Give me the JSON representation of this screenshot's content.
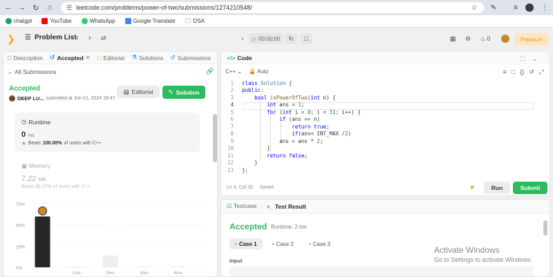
{
  "browser": {
    "url": "leetcode.com/problems/power-of-two/submissions/1274210548/",
    "bookmarks": [
      {
        "label": "chatgpt",
        "color": "#10a37f"
      },
      {
        "label": "YouTube",
        "color": "#ff0000"
      },
      {
        "label": "WhatsApp",
        "color": "#25d366"
      },
      {
        "label": "Google Translate",
        "color": "#4285f4"
      },
      {
        "label": "DSA",
        "color": "#555555"
      }
    ]
  },
  "topbar": {
    "problem_list": "Problem List",
    "timer": "00:00:00",
    "fire_count": "0",
    "premium": "Premium"
  },
  "left": {
    "tabs": [
      "Description",
      "Accepted",
      "Editorial",
      "Solutions",
      "Submissions"
    ],
    "all_submissions": "All Submissions",
    "status": "Accepted",
    "user": "DEEP LU...",
    "submitted_text": "submitted at Jun 01, 2024 18:47",
    "editorial_btn": "Editorial",
    "solution_btn": "Solution",
    "runtime": {
      "title": "Runtime",
      "value": "0",
      "unit": "ms",
      "beats_label": "Beats",
      "beats_pct": "100.00%",
      "beats_suffix": "of users with C++"
    },
    "memory": {
      "title": "Memory",
      "value": "7.22",
      "unit": "MB",
      "beats_text": "Beats 36.77% of users with C++"
    }
  },
  "chart_data": {
    "type": "bar",
    "y_ticks": [
      "75%",
      "50%",
      "25%",
      "0%"
    ],
    "ylim": [
      0,
      75
    ],
    "x_ticks": [
      "1ms",
      "2ms",
      "3ms",
      "4ms"
    ],
    "values": [
      60,
      1,
      14,
      1,
      1
    ],
    "highlight_index": 0
  },
  "code": {
    "title": "Code",
    "lang": "C++",
    "auto": "Auto",
    "lines": [
      "class Solution {",
      "public:",
      "    bool isPowerOfTwo(int n) {",
      "        int ans = 1;",
      "        for (int i = 0; i < 31; i++) {",
      "            if (ans == n)",
      "                return true;",
      "                if(ans< INT_MAX /2)",
      "            ans = ans * 2;",
      "        }",
      "        return false;",
      "    }",
      "};"
    ],
    "cursor": "Ln 4, Col 20",
    "saved": "Saved",
    "run": "Run",
    "submit": "Submit"
  },
  "result": {
    "testcase_tab": "Testcase",
    "result_tab": "Test Result",
    "status": "Accepted",
    "runtime": "Runtime: 2 ms",
    "cases": [
      "Case 1",
      "Case 2",
      "Case 3"
    ],
    "input_label": "Input"
  },
  "watermark": {
    "line1": "Activate Windows",
    "line2": "Go to Settings to activate Windows."
  }
}
